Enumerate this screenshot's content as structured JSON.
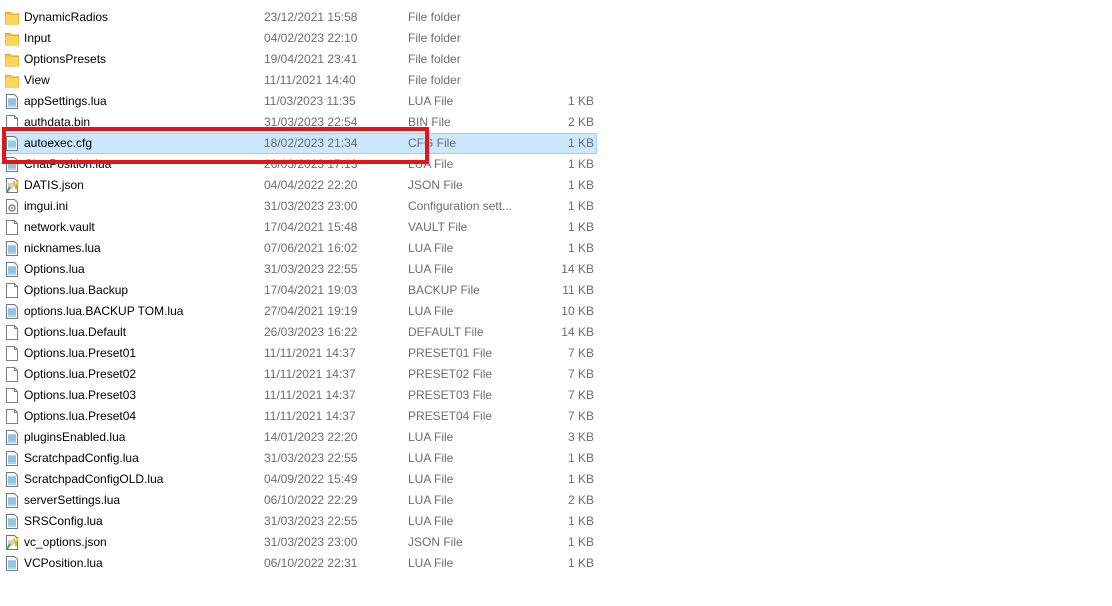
{
  "files": [
    {
      "name": "DynamicRadios",
      "date": "23/12/2021 15:58",
      "type": "File folder",
      "size": "",
      "icon": "folder-icon",
      "selected": false
    },
    {
      "name": "Input",
      "date": "04/02/2023 22:10",
      "type": "File folder",
      "size": "",
      "icon": "folder-icon",
      "selected": false
    },
    {
      "name": "OptionsPresets",
      "date": "19/04/2021 23:41",
      "type": "File folder",
      "size": "",
      "icon": "folder-icon",
      "selected": false
    },
    {
      "name": "View",
      "date": "11/11/2021 14:40",
      "type": "File folder",
      "size": "",
      "icon": "folder-icon",
      "selected": false
    },
    {
      "name": "appSettings.lua",
      "date": "11/03/2023 11:35",
      "type": "LUA File",
      "size": "1 KB",
      "icon": "lua-file-icon",
      "selected": false
    },
    {
      "name": "authdata.bin",
      "date": "31/03/2023 22:54",
      "type": "BIN File",
      "size": "2 KB",
      "icon": "blank-file-icon",
      "selected": false
    },
    {
      "name": "autoexec.cfg",
      "date": "18/02/2023 21:34",
      "type": "CFG File",
      "size": "1 KB",
      "icon": "cfg-file-icon",
      "selected": true
    },
    {
      "name": "ChatPosition.lua",
      "date": "26/03/2023 17:13",
      "type": "LUA File",
      "size": "1 KB",
      "icon": "lua-file-icon",
      "selected": false
    },
    {
      "name": "DATIS.json",
      "date": "04/04/2022 22:20",
      "type": "JSON File",
      "size": "1 KB",
      "icon": "json-file-icon",
      "selected": false
    },
    {
      "name": "imgui.ini",
      "date": "31/03/2023 23:00",
      "type": "Configuration sett...",
      "size": "1 KB",
      "icon": "settings-file-icon",
      "selected": false
    },
    {
      "name": "network.vault",
      "date": "17/04/2021 15:48",
      "type": "VAULT File",
      "size": "1 KB",
      "icon": "blank-file-icon",
      "selected": false
    },
    {
      "name": "nicknames.lua",
      "date": "07/06/2021 16:02",
      "type": "LUA File",
      "size": "1 KB",
      "icon": "lua-file-icon",
      "selected": false
    },
    {
      "name": "Options.lua",
      "date": "31/03/2023 22:55",
      "type": "LUA File",
      "size": "14 KB",
      "icon": "lua-file-icon",
      "selected": false
    },
    {
      "name": "Options.lua.Backup",
      "date": "17/04/2021 19:03",
      "type": "BACKUP File",
      "size": "11 KB",
      "icon": "blank-file-icon",
      "selected": false
    },
    {
      "name": "options.lua.BACKUP TOM.lua",
      "date": "27/04/2021 19:19",
      "type": "LUA File",
      "size": "10 KB",
      "icon": "lua-file-icon",
      "selected": false
    },
    {
      "name": "Options.lua.Default",
      "date": "26/03/2023 16:22",
      "type": "DEFAULT File",
      "size": "14 KB",
      "icon": "blank-file-icon",
      "selected": false
    },
    {
      "name": "Options.lua.Preset01",
      "date": "11/11/2021 14:37",
      "type": "PRESET01 File",
      "size": "7 KB",
      "icon": "blank-file-icon",
      "selected": false
    },
    {
      "name": "Options.lua.Preset02",
      "date": "11/11/2021 14:37",
      "type": "PRESET02 File",
      "size": "7 KB",
      "icon": "blank-file-icon",
      "selected": false
    },
    {
      "name": "Options.lua.Preset03",
      "date": "11/11/2021 14:37",
      "type": "PRESET03 File",
      "size": "7 KB",
      "icon": "blank-file-icon",
      "selected": false
    },
    {
      "name": "Options.lua.Preset04",
      "date": "11/11/2021 14:37",
      "type": "PRESET04 File",
      "size": "7 KB",
      "icon": "blank-file-icon",
      "selected": false
    },
    {
      "name": "pluginsEnabled.lua",
      "date": "14/01/2023 22:20",
      "type": "LUA File",
      "size": "3 KB",
      "icon": "lua-file-icon",
      "selected": false
    },
    {
      "name": "ScratchpadConfig.lua",
      "date": "31/03/2023 22:55",
      "type": "LUA File",
      "size": "1 KB",
      "icon": "lua-file-icon",
      "selected": false
    },
    {
      "name": "ScratchpadConfigOLD.lua",
      "date": "04/09/2022 15:49",
      "type": "LUA File",
      "size": "1 KB",
      "icon": "lua-file-icon",
      "selected": false
    },
    {
      "name": "serverSettings.lua",
      "date": "06/10/2022 22:29",
      "type": "LUA File",
      "size": "2 KB",
      "icon": "lua-file-icon",
      "selected": false
    },
    {
      "name": "SRSConfig.lua",
      "date": "31/03/2023 22:55",
      "type": "LUA File",
      "size": "1 KB",
      "icon": "lua-file-icon",
      "selected": false
    },
    {
      "name": "vc_options.json",
      "date": "31/03/2023 23:00",
      "type": "JSON File",
      "size": "1 KB",
      "icon": "json-file-icon",
      "selected": false
    },
    {
      "name": "VCPosition.lua",
      "date": "06/10/2022 22:31",
      "type": "LUA File",
      "size": "1 KB",
      "icon": "lua-file-icon",
      "selected": false
    }
  ],
  "colors": {
    "selection_bg": "#cce8ff",
    "selection_border": "#99d1ff",
    "highlight_box": "#e3141e",
    "secondary_text": "#6d6d6d",
    "folder": "#f7c843"
  }
}
